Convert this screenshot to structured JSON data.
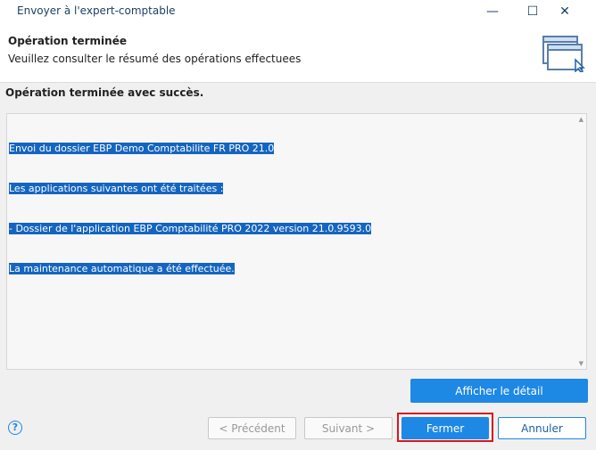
{
  "window": {
    "title": "Envoyer à l'expert-comptable",
    "minimize_glyph": "—",
    "maximize_glyph": "☐",
    "close_glyph": "✕"
  },
  "header": {
    "title": "Opération terminée",
    "subtitle": "Veuillez consulter le résumé des opérations effectuees",
    "icon": "window-cursor-icon"
  },
  "main": {
    "status_text": "Opération terminée avec succès.",
    "log_lines": [
      "Envoi du dossier EBP Demo Comptabilite FR PRO 21.0",
      "Les applications suivantes ont été traitées :",
      "- Dossier de l'application EBP Comptabilité PRO 2022 version 21.0.9593.0",
      "La maintenance automatique a été effectuée."
    ],
    "selection_color": "#1565c0"
  },
  "buttons": {
    "details": "Afficher le détail",
    "help": "?",
    "previous": "< Précédent",
    "next": "Suivant >",
    "close": "Fermer",
    "cancel": "Annuler"
  },
  "colors": {
    "accent": "#1e88e5",
    "highlight_frame": "#d9161f"
  }
}
